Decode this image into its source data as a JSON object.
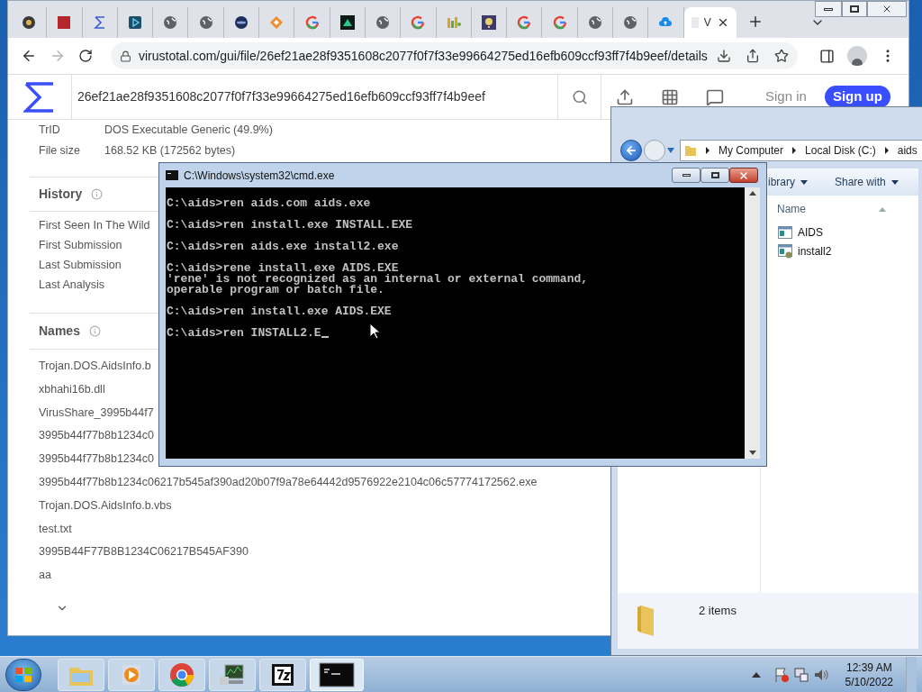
{
  "browser": {
    "tabs": [
      {
        "kind": "vb",
        "selected": false
      },
      {
        "kind": "red-square",
        "selected": false
      },
      {
        "kind": "sigma",
        "selected": false
      },
      {
        "kind": "play",
        "selected": false
      },
      {
        "kind": "globe",
        "selected": false
      },
      {
        "kind": "globe",
        "selected": false
      },
      {
        "kind": "dark-circle",
        "selected": false
      },
      {
        "kind": "diamond",
        "selected": false
      },
      {
        "kind": "google",
        "selected": false
      },
      {
        "kind": "triangle",
        "selected": false
      },
      {
        "kind": "globe",
        "selected": false
      },
      {
        "kind": "google",
        "selected": false
      },
      {
        "kind": "bars",
        "selected": false
      },
      {
        "kind": "question",
        "selected": false
      },
      {
        "kind": "google",
        "selected": false
      },
      {
        "kind": "google",
        "selected": false
      },
      {
        "kind": "globe",
        "selected": false
      },
      {
        "kind": "globe",
        "selected": false
      },
      {
        "kind": "cloud",
        "selected": false
      },
      {
        "kind": "page",
        "selected": true,
        "title": "V"
      }
    ],
    "url": "virustotal.com/gui/file/26ef21ae28f9351608c2077f0f7f33e99664275ed16efb609ccf93ff7f4b9eef/details"
  },
  "virustotal": {
    "search_value": "26ef21ae28f9351608c2077f0f7f33e99664275ed16efb609ccf93ff7f4b9eef",
    "sign_in": "Sign in",
    "sign_up": "Sign up",
    "properties": [
      {
        "label": "TrID",
        "value": "DOS Executable Generic (49.9%)"
      },
      {
        "label": "File size",
        "value": "168.52 KB (172562 bytes)"
      }
    ],
    "history": {
      "title": "History",
      "rows": [
        "First Seen In The Wild",
        "First Submission",
        "Last Submission",
        "Last Analysis"
      ]
    },
    "names": {
      "title": "Names",
      "items": [
        "Trojan.DOS.AidsInfo.b",
        "xbhahi16b.dll",
        "VirusShare_3995b44f7",
        "3995b44f77b8b1234c0",
        "3995b44f77b8b1234c0",
        "3995b44f77b8b1234c06217b545af390ad20b07f9a78e64442d9576922e2104c06c57774172562.exe",
        "Trojan.DOS.AidsInfo.b.vbs",
        "test.txt",
        "3995B44F77B8B1234C06217B545AF390",
        "aa"
      ]
    }
  },
  "cmd": {
    "title": "C:\\Windows\\system32\\cmd.exe",
    "entries": [
      {
        "kind": "command",
        "text": "C:\\aids>ren aids.com aids.exe"
      },
      {
        "kind": "command",
        "text": "C:\\aids>ren install.exe INSTALL.EXE"
      },
      {
        "kind": "command",
        "text": "C:\\aids>ren aids.exe install2.exe"
      },
      {
        "kind": "command",
        "text": "C:\\aids>rene install.exe AIDS.EXE"
      },
      {
        "kind": "output",
        "text": "'rene' is not recognized as an internal or external command,"
      },
      {
        "kind": "output",
        "text": "operable program or batch file."
      },
      {
        "kind": "command",
        "text": "C:\\aids>ren install.exe AIDS.EXE"
      },
      {
        "kind": "input",
        "text": "C:\\aids>ren INSTALL2.E"
      }
    ]
  },
  "explorer": {
    "breadcrumb": [
      "My Computer",
      "Local Disk (C:)",
      "aids"
    ],
    "toolbar": [
      "ibrary",
      "Share with"
    ],
    "column": "Name",
    "files": [
      {
        "name": "AIDS",
        "kind": "program"
      },
      {
        "name": "install2",
        "kind": "setup"
      }
    ],
    "status": "2 items"
  },
  "taskbar": {
    "apps": [
      {
        "kind": "explorer",
        "selected": false
      },
      {
        "kind": "media",
        "selected": false
      },
      {
        "kind": "chrome",
        "selected": false
      },
      {
        "kind": "monitor",
        "selected": false
      },
      {
        "kind": "archive",
        "selected": false
      },
      {
        "kind": "console",
        "selected": true
      }
    ],
    "time": "12:39 AM",
    "date": "5/10/2022"
  }
}
